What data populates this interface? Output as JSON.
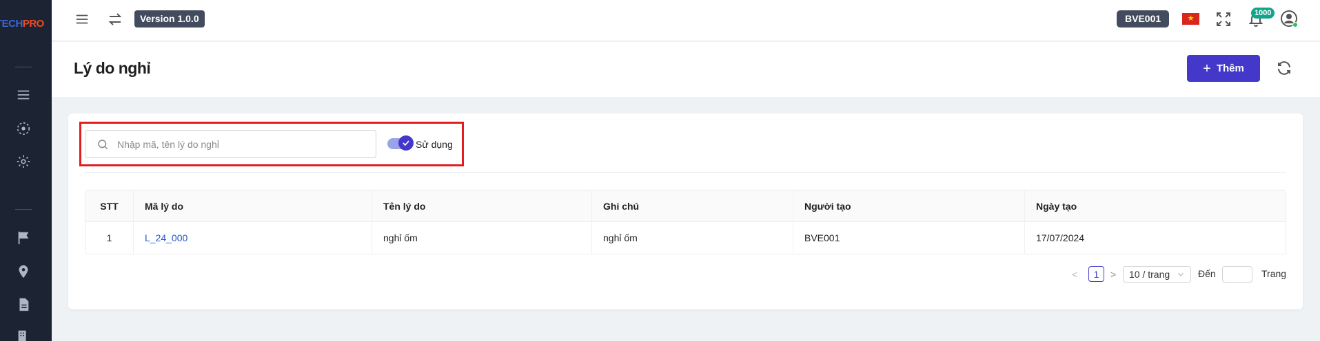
{
  "app": {
    "logo_part1": "TECH",
    "logo_part2": "PRO",
    "version_label": "Version 1.0.0",
    "user_code": "BVE001",
    "notification_count": "1000",
    "flag_star": "★"
  },
  "page": {
    "title": "Lý do nghỉ",
    "add_label": "Thêm",
    "add_plus": "+"
  },
  "filters": {
    "search_placeholder": "Nhập mã, tên lý do nghỉ",
    "search_value": "",
    "toggle_label": "Sử dụng",
    "toggle_on": true
  },
  "table": {
    "columns": [
      "STT",
      "Mã lý do",
      "Tên lý do",
      "Ghi chú",
      "Người tạo",
      "Ngày tạo"
    ],
    "rows": [
      {
        "stt": "1",
        "code": "L_24_000",
        "name": "nghỉ ốm",
        "note": "nghỉ ốm",
        "creator": "BVE001",
        "created": "17/07/2024"
      }
    ]
  },
  "pagination": {
    "prev": "<",
    "current_page": "1",
    "next": ">",
    "page_size": "10 / trang",
    "goto_label": "Đến",
    "goto_suffix": "Trang"
  },
  "colors": {
    "sidebar_bg": "#1c2434",
    "primary": "#4338ca",
    "highlight_border": "#e11d1d",
    "link": "#2456c8",
    "badge_bg": "#434c5e",
    "notification_badge": "#13a58a"
  }
}
